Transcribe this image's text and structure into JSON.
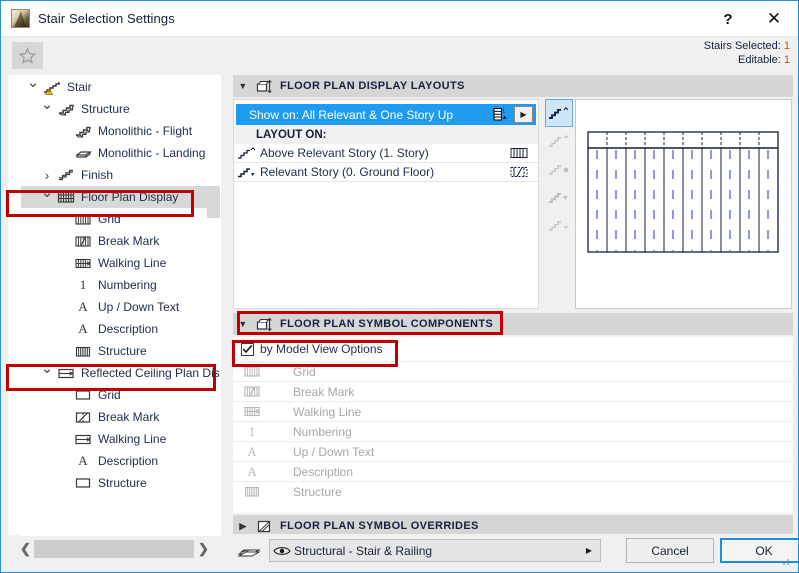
{
  "window": {
    "title": "Stair Selection Settings",
    "app_icon": "stair-app-icon",
    "help_label": "?",
    "close_label": "✕"
  },
  "subheader": {
    "favorite_icon": "star-icon",
    "stairs_selected_label": "Stairs Selected:",
    "stairs_selected_value": "1",
    "editable_label": "Editable:",
    "editable_value": "1"
  },
  "tree": {
    "items": [
      {
        "label": "Stair",
        "indent": 0,
        "twisty": "down",
        "icon": "stair-warning-icon",
        "selected": false
      },
      {
        "label": "Structure",
        "indent": 1,
        "twisty": "down",
        "icon": "structure-icon",
        "selected": false
      },
      {
        "label": "Monolithic - Flight",
        "indent": 2,
        "twisty": "none",
        "icon": "flight-icon",
        "selected": false
      },
      {
        "label": "Monolithic - Landing",
        "indent": 2,
        "twisty": "none",
        "icon": "landing-icon",
        "selected": false
      },
      {
        "label": "Finish",
        "indent": 1,
        "twisty": "right",
        "icon": "finish-icon",
        "selected": false
      },
      {
        "label": "Floor Plan Display",
        "indent": 1,
        "twisty": "down",
        "icon": "floorplan-grid-icon",
        "selected": true
      },
      {
        "label": "Grid",
        "indent": 2,
        "twisty": "none",
        "icon": "grid-icon",
        "selected": false
      },
      {
        "label": "Break Mark",
        "indent": 2,
        "twisty": "none",
        "icon": "breakmark-icon",
        "selected": false
      },
      {
        "label": "Walking Line",
        "indent": 2,
        "twisty": "none",
        "icon": "walkingline-icon",
        "selected": false
      },
      {
        "label": "Numbering",
        "indent": 2,
        "twisty": "none",
        "icon": "numbering-icon",
        "selected": false
      },
      {
        "label": "Up / Down Text",
        "indent": 2,
        "twisty": "none",
        "icon": "text-a-icon",
        "selected": false
      },
      {
        "label": "Description",
        "indent": 2,
        "twisty": "none",
        "icon": "text-a-icon",
        "selected": false
      },
      {
        "label": "Structure",
        "indent": 2,
        "twisty": "none",
        "icon": "structure-hatch-icon",
        "selected": false
      },
      {
        "label": "Reflected Ceiling Plan Displa",
        "indent": 1,
        "twisty": "down",
        "icon": "rcp-icon",
        "selected": false
      },
      {
        "label": "Grid",
        "indent": 2,
        "twisty": "none",
        "icon": "rect-icon",
        "selected": false
      },
      {
        "label": "Break Mark",
        "indent": 2,
        "twisty": "none",
        "icon": "rcp-breakmark-icon",
        "selected": false
      },
      {
        "label": "Walking Line",
        "indent": 2,
        "twisty": "none",
        "icon": "rcp-walkline-icon",
        "selected": false
      },
      {
        "label": "Description",
        "indent": 2,
        "twisty": "none",
        "icon": "text-a-icon",
        "selected": false
      },
      {
        "label": "Structure",
        "indent": 2,
        "twisty": "none",
        "icon": "rect-icon",
        "selected": false
      }
    ],
    "hscroll_left_label": "❮",
    "hscroll_right_label": "❯"
  },
  "sections": {
    "layouts": {
      "title": "FLOOR PLAN DISPLAY LAYOUTS",
      "expanded": true,
      "arrow": "▼",
      "icon": "layouts-icon"
    },
    "components": {
      "title": "FLOOR PLAN SYMBOL COMPONENTS",
      "expanded": true,
      "arrow": "▼",
      "icon": "components-icon"
    },
    "overrides": {
      "title": "FLOOR PLAN SYMBOL OVERRIDES",
      "expanded": false,
      "arrow": "▶",
      "icon": "overrides-icon"
    }
  },
  "layouts": {
    "show_on": "Show on: All Relevant & One Story Up",
    "show_on_icon": "story-stack-icon",
    "show_on_next_label": "▶",
    "layout_on_header": "LAYOUT ON:",
    "rows": [
      {
        "label": "Above Relevant Story (1. Story)",
        "icon": "stair-up-icon",
        "right_icon": "grid-swatch-icon"
      },
      {
        "label": "Relevant Story (0. Ground Floor)",
        "icon": "stair-down-icon",
        "right_icon": "break-swatch-icon"
      }
    ]
  },
  "tool_strip": {
    "buttons": [
      {
        "name": "stair-view-above-one-up",
        "active": true
      },
      {
        "name": "stair-view-above",
        "active": false
      },
      {
        "name": "stair-view-relevant-dot",
        "active": false
      },
      {
        "name": "stair-view-relevant",
        "active": false
      },
      {
        "name": "stair-view-below",
        "active": false
      }
    ]
  },
  "preview": {
    "name": "stair-floor-plan-preview"
  },
  "components": {
    "by_model_view_label": "by Model View Options",
    "by_model_view_checked": true,
    "rows": [
      {
        "label": "Grid",
        "icon": "grid-icon"
      },
      {
        "label": "Break Mark",
        "icon": "breakmark-icon"
      },
      {
        "label": "Walking Line",
        "icon": "walkingline-icon"
      },
      {
        "label": "Numbering",
        "icon": "numbering-icon"
      },
      {
        "label": "Up / Down Text",
        "icon": "text-a-icon"
      },
      {
        "label": "Description",
        "icon": "text-a-icon"
      },
      {
        "label": "Structure",
        "icon": "structure-hatch-icon"
      }
    ]
  },
  "bottom": {
    "pen_icon": "pen-set-icon",
    "combo_eye_icon": "eye-icon",
    "combo_value": "Structural - Stair & Railing",
    "combo_arrow": "▶",
    "cancel_label": "Cancel",
    "ok_label": "OK"
  },
  "colors": {
    "accent_blue": "#1f9cf0",
    "highlight_red": "#c00000",
    "selection_gray": "#d8d8d8",
    "header_gray": "#d6d6d6",
    "ok_border": "#1f8ddc",
    "status_orange": "#b05a12"
  }
}
